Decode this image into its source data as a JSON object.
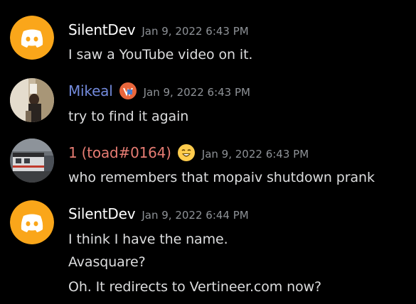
{
  "colors": {
    "background": "#000000",
    "message_text": "#dcddde",
    "timestamp": "#8e9297",
    "username_default": "#ffffff",
    "username_mikeal": "#7289da",
    "username_toad": "#e67c73",
    "discord_avatar_bg": "#faa61a"
  },
  "messages": [
    {
      "author": "SilentDev",
      "avatar_icon": "discord-logo-icon",
      "timestamp": "Jan 9, 2022 6:43 PM",
      "lines": [
        "I saw a YouTube video on it."
      ]
    },
    {
      "author": "Mikeal",
      "avatar_icon": "photo-avatar",
      "badge_icon": "role-badge-icon",
      "timestamp": "Jan 9, 2022 6:43 PM",
      "lines": [
        "try to find it again"
      ]
    },
    {
      "author": "1 (toad#0164)",
      "avatar_icon": "train-photo-avatar",
      "badge_icon": "laughing-emoji-badge-icon",
      "timestamp": "Jan 9, 2022 6:43 PM",
      "lines": [
        "who remembers that mopaiv shutdown prank"
      ]
    },
    {
      "author": "SilentDev",
      "avatar_icon": "discord-logo-icon",
      "timestamp": "Jan 9, 2022 6:44 PM",
      "lines": [
        "I think I have the name.",
        "Avasquare?",
        "Oh. It redirects to Vertineer.com now?"
      ]
    }
  ]
}
